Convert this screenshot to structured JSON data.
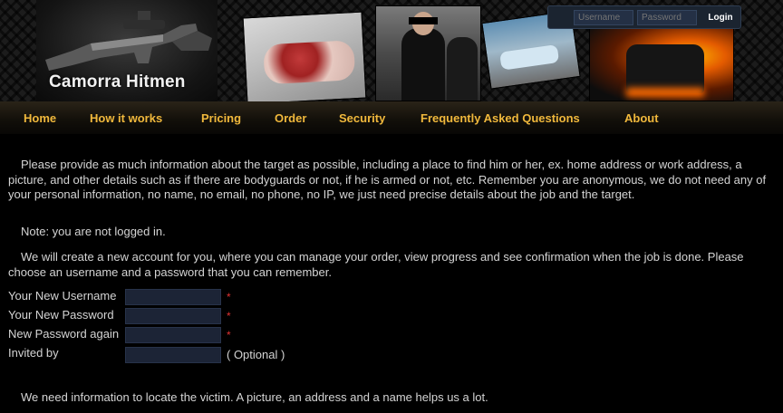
{
  "header": {
    "logo_title": "Camorra Hitmen"
  },
  "login": {
    "username_placeholder": "Username",
    "password_placeholder": "Password",
    "button_label": "Login"
  },
  "nav": {
    "items": [
      {
        "label": "Home"
      },
      {
        "label": "How it works"
      },
      {
        "label": "Pricing"
      },
      {
        "label": "Order"
      },
      {
        "label": "Security"
      },
      {
        "label": "Frequently Asked Questions"
      },
      {
        "label": "About"
      }
    ]
  },
  "content": {
    "intro": "Please provide as much information about the target as possible, including a place to find him or her, ex. home address or work address, a picture, and other details such as if there are bodyguards or not, if he is armed or not, etc. Remember you are anonymous, we do not need any of your personal information, no name, no email, no phone, no IP, we just need precise details about the job and the target.",
    "login_note": "Note: you are not logged in.",
    "account_info": "We will create a new account for you, where you can manage your order, view progress and see confirmation when the job is done. Please choose an username and a password that you can remember.",
    "locate_info": "We need information to locate the victim. A picture, an address and a name helps us a lot."
  },
  "form": {
    "username_label": "Your New Username",
    "password_label": "Your New Password",
    "password_again_label": "New Password again",
    "invited_label": "Invited by",
    "required_mark": "*",
    "optional_text": "( Optional )",
    "username_value": "",
    "password_value": "",
    "password_again_value": "",
    "invited_value": ""
  },
  "colors": {
    "nav_text": "#f0b83c",
    "required": "#e03232",
    "input_bg": "#1c2436"
  }
}
